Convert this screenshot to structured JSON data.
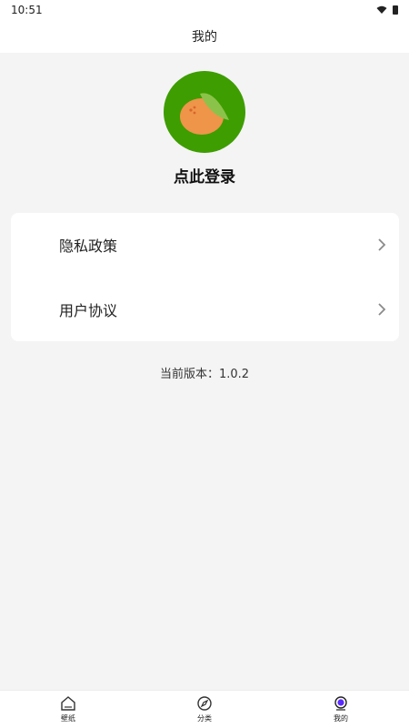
{
  "status_bar": {
    "time": "10:51"
  },
  "app_bar": {
    "title": "我的"
  },
  "profile": {
    "login_label": "点此登录"
  },
  "menu": {
    "items": [
      {
        "label": "隐私政策"
      },
      {
        "label": "用户协议"
      }
    ]
  },
  "version_text": "当前版本：1.0.2",
  "bottom_nav": {
    "items": [
      {
        "label": "壁纸",
        "icon": "home-icon"
      },
      {
        "label": "分类",
        "icon": "compass-icon"
      },
      {
        "label": "我的",
        "icon": "profile-icon"
      }
    ]
  },
  "colors": {
    "accent_green": "#3e9d00",
    "orange": "#ee9549",
    "leaf_green": "#8bc34a",
    "active_purple": "#5b2cff"
  }
}
